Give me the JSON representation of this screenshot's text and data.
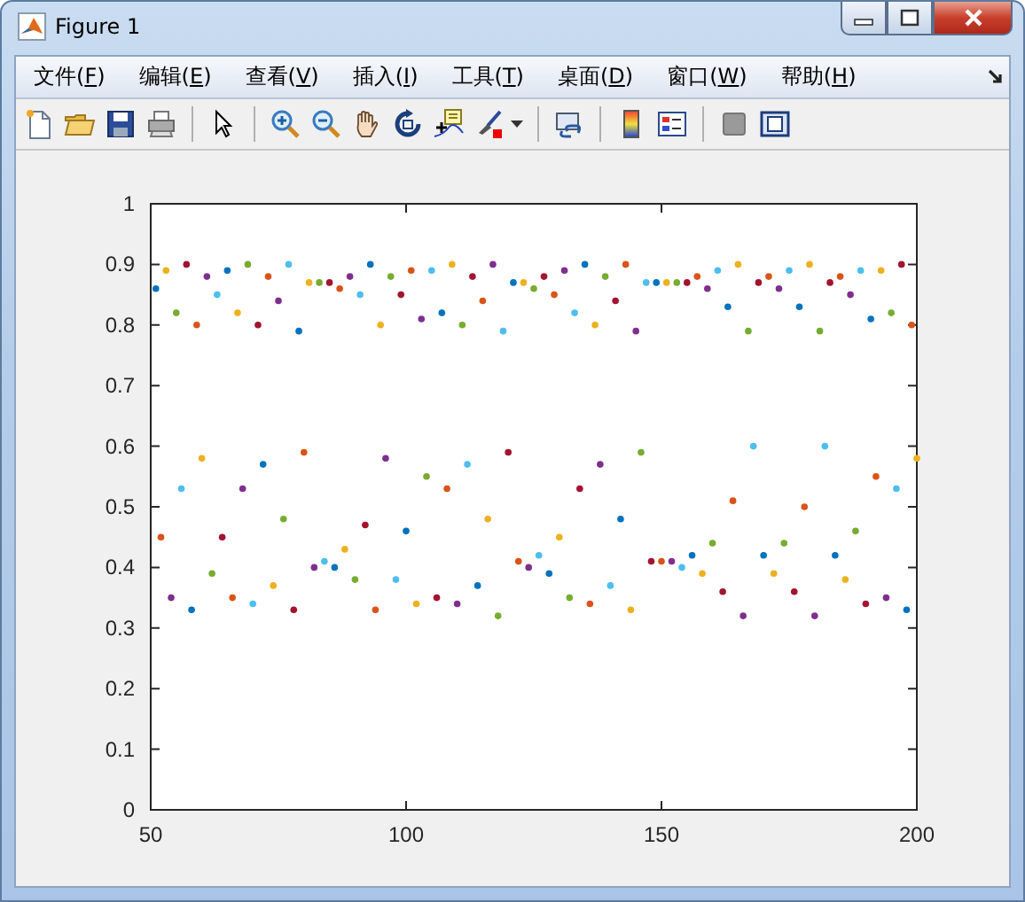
{
  "window": {
    "title": "Figure 1"
  },
  "menu": [
    {
      "label": "文件(F)"
    },
    {
      "label": "编辑(E)"
    },
    {
      "label": "查看(V)"
    },
    {
      "label": "插入(I)"
    },
    {
      "label": "工具(T)"
    },
    {
      "label": "桌面(D)"
    },
    {
      "label": "窗口(W)"
    },
    {
      "label": "帮助(H)"
    }
  ],
  "figure": {
    "chart_data": {
      "type": "scatter",
      "xlim": [
        50,
        200
      ],
      "ylim": [
        0,
        1
      ],
      "xticks": [
        50,
        100,
        150,
        200
      ],
      "yticks": [
        0,
        0.1,
        0.2,
        0.3,
        0.4,
        0.5,
        0.6,
        0.7,
        0.8,
        0.9,
        1
      ],
      "series": [
        {
          "color": "#0072bd",
          "x": [
            51,
            58,
            65,
            72,
            79,
            86,
            93,
            100,
            107,
            114,
            121,
            128,
            135,
            142,
            149,
            156,
            163,
            170,
            177,
            184,
            191,
            198
          ],
          "values": [
            0.86,
            0.33,
            0.89,
            0.57,
            0.79,
            0.4,
            0.9,
            0.46,
            0.82,
            0.37,
            0.87,
            0.39,
            0.9,
            0.48,
            0.87,
            0.42,
            0.83,
            0.42,
            0.83,
            0.42,
            0.81,
            0.33
          ]
        },
        {
          "color": "#edb120",
          "x": [
            53,
            60,
            67,
            74,
            81,
            88,
            95,
            102,
            109,
            116,
            123,
            130,
            137,
            144,
            151,
            158,
            165,
            172,
            179,
            186,
            193,
            200
          ],
          "values": [
            0.89,
            0.58,
            0.82,
            0.37,
            0.87,
            0.43,
            0.8,
            0.34,
            0.9,
            0.48,
            0.87,
            0.45,
            0.8,
            0.33,
            0.87,
            0.39,
            0.9,
            0.39,
            0.9,
            0.38,
            0.89,
            0.58
          ]
        },
        {
          "color": "#77ac30",
          "x": [
            55,
            62,
            69,
            76,
            83,
            90,
            97,
            104,
            111,
            118,
            125,
            132,
            139,
            146,
            153,
            160,
            167,
            174,
            181,
            188,
            195
          ],
          "values": [
            0.82,
            0.39,
            0.9,
            0.48,
            0.87,
            0.38,
            0.88,
            0.55,
            0.8,
            0.32,
            0.86,
            0.35,
            0.88,
            0.59,
            0.87,
            0.44,
            0.79,
            0.44,
            0.79,
            0.46,
            0.82
          ]
        },
        {
          "color": "#a2142f",
          "x": [
            57,
            64,
            71,
            78,
            85,
            92,
            99,
            106,
            113,
            120,
            127,
            134,
            141,
            148,
            155,
            162,
            169,
            176,
            183,
            190,
            197
          ],
          "values": [
            0.9,
            0.45,
            0.8,
            0.33,
            0.87,
            0.47,
            0.85,
            0.35,
            0.88,
            0.59,
            0.88,
            0.53,
            0.84,
            0.41,
            0.87,
            0.36,
            0.87,
            0.36,
            0.87,
            0.34,
            0.9
          ]
        },
        {
          "color": "#d95319",
          "x": [
            52,
            59,
            66,
            73,
            80,
            87,
            94,
            101,
            108,
            115,
            122,
            129,
            136,
            143,
            150,
            157,
            164,
            171,
            178,
            185,
            192,
            199
          ],
          "values": [
            0.45,
            0.8,
            0.35,
            0.88,
            0.59,
            0.86,
            0.33,
            0.89,
            0.53,
            0.84,
            0.41,
            0.85,
            0.34,
            0.9,
            0.41,
            0.88,
            0.51,
            0.88,
            0.5,
            0.88,
            0.55,
            0.8
          ]
        },
        {
          "color": "#7e2f8e",
          "x": [
            54,
            61,
            68,
            75,
            82,
            89,
            96,
            103,
            110,
            117,
            124,
            131,
            138,
            145,
            152,
            159,
            166,
            173,
            180,
            187,
            194
          ],
          "values": [
            0.35,
            0.88,
            0.53,
            0.84,
            0.4,
            0.88,
            0.58,
            0.81,
            0.34,
            0.9,
            0.4,
            0.89,
            0.57,
            0.79,
            0.41,
            0.86,
            0.32,
            0.86,
            0.32,
            0.85,
            0.35
          ]
        },
        {
          "color": "#4dbeee",
          "x": [
            56,
            63,
            70,
            77,
            84,
            91,
            98,
            105,
            112,
            119,
            126,
            133,
            140,
            147,
            154,
            161,
            168,
            175,
            182,
            189,
            196
          ],
          "values": [
            0.53,
            0.85,
            0.34,
            0.9,
            0.41,
            0.85,
            0.38,
            0.89,
            0.57,
            0.79,
            0.42,
            0.82,
            0.37,
            0.87,
            0.4,
            0.89,
            0.6,
            0.89,
            0.6,
            0.89,
            0.53
          ]
        }
      ]
    }
  }
}
